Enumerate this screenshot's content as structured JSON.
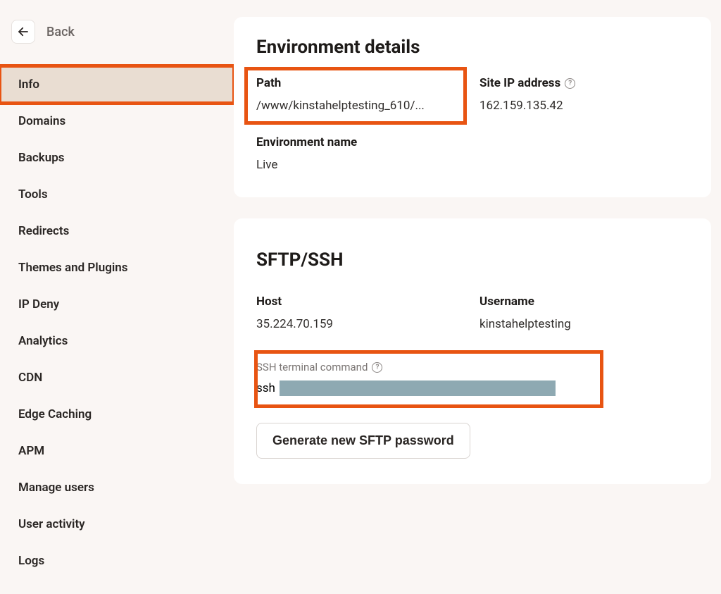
{
  "back": {
    "label": "Back"
  },
  "sidebar": {
    "items": [
      {
        "label": "Info",
        "active": true
      },
      {
        "label": "Domains"
      },
      {
        "label": "Backups"
      },
      {
        "label": "Tools"
      },
      {
        "label": "Redirects"
      },
      {
        "label": "Themes and Plugins"
      },
      {
        "label": "IP Deny"
      },
      {
        "label": "Analytics"
      },
      {
        "label": "CDN"
      },
      {
        "label": "Edge Caching"
      },
      {
        "label": "APM"
      },
      {
        "label": "Manage users"
      },
      {
        "label": "User activity"
      },
      {
        "label": "Logs"
      }
    ]
  },
  "env_details": {
    "title": "Environment details",
    "path": {
      "label": "Path",
      "value": "/www/kinstahelptesting_610/..."
    },
    "ip": {
      "label": "Site IP address",
      "value": "162.159.135.42"
    },
    "env_name": {
      "label": "Environment name",
      "value": "Live"
    }
  },
  "sftp": {
    "title": "SFTP/SSH",
    "host": {
      "label": "Host",
      "value": "35.224.70.159"
    },
    "username": {
      "label": "Username",
      "value": "kinstahelptesting"
    },
    "ssh_cmd": {
      "label": "SSH terminal command",
      "prefix": "ssh"
    },
    "generate_button": "Generate new SFTP password"
  },
  "colors": {
    "highlight": "#E85412",
    "sidebar_active_bg": "#E9DDD2",
    "redaction": "#8EA9B2"
  }
}
